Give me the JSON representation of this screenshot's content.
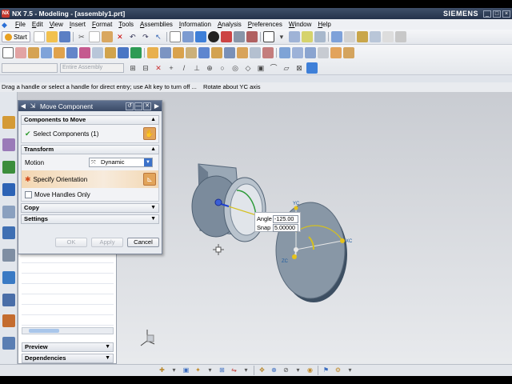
{
  "window": {
    "title": "NX 7.5 - Modeling - [assembly1.prt]",
    "brand": "SIEMENS",
    "controls": [
      "_",
      "□",
      "×"
    ]
  },
  "menu": [
    "File",
    "Edit",
    "View",
    "Insert",
    "Format",
    "Tools",
    "Assemblies",
    "Information",
    "Analysis",
    "Preferences",
    "Window",
    "Help"
  ],
  "toolbar": {
    "start_label": "Start",
    "selection_filter": "Entire Assembly"
  },
  "cue_line": {
    "prompt": "Drag a handle or select a handle for direct entry; use Alt key to turn off ...",
    "status": "Rotate about YC axis"
  },
  "dialog": {
    "title": "Move Component",
    "components_group": "Components to Move",
    "select_components": "Select Components (1)",
    "transform_group": "Transform",
    "motion_label": "Motion",
    "motion_value": "Dynamic",
    "specify_orientation": "Specify Orientation",
    "move_handles_only": "Move Handles Only",
    "copy_group": "Copy",
    "settings_group": "Settings",
    "ok": "OK",
    "apply": "Apply",
    "cancel": "Cancel"
  },
  "navigator": {
    "preview": "Preview",
    "dependencies": "Dependencies"
  },
  "handle_input": {
    "angle_label": "Angle",
    "angle_value": "-125.00",
    "snap_label": "Snap",
    "snap_value": "5.00000"
  },
  "axis_labels": {
    "xc": "XC",
    "yc": "YC",
    "zc": "ZC"
  }
}
